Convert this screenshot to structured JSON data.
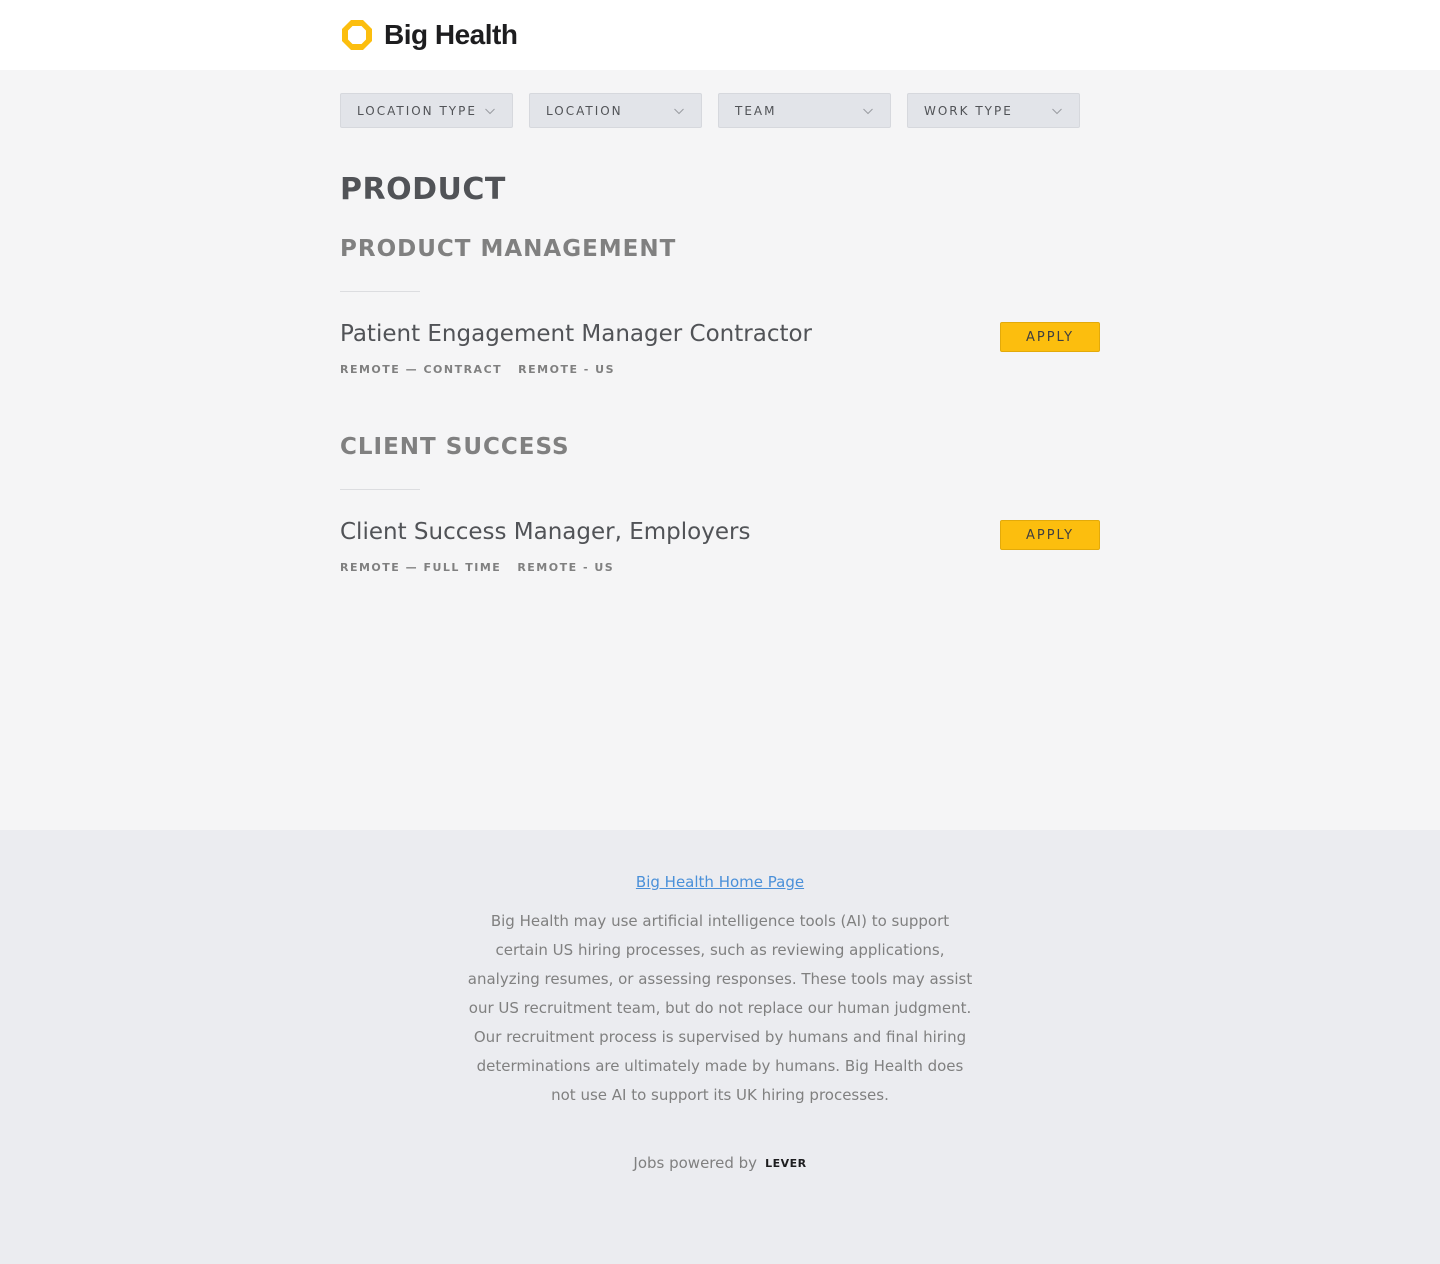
{
  "brand": {
    "name": "Big Health",
    "accent": "#fcbe0e"
  },
  "filters": [
    {
      "label": "LOCATION TYPE",
      "icon": "chevron-down-icon"
    },
    {
      "label": "LOCATION",
      "icon": "chevron-down-icon"
    },
    {
      "label": "TEAM",
      "icon": "chevron-down-icon"
    },
    {
      "label": "WORK TYPE",
      "icon": "chevron-down-icon"
    }
  ],
  "department": {
    "title": "PRODUCT",
    "teams": [
      {
        "title": "PRODUCT MANAGEMENT",
        "postings": [
          {
            "title": "Patient Engagement Manager Contractor",
            "commitment": "REMOTE — CONTRACT",
            "location": "REMOTE - US",
            "apply_label": "APPLY"
          }
        ]
      },
      {
        "title": "CLIENT SUCCESS",
        "postings": [
          {
            "title": "Client Success Manager, Employers",
            "commitment": "REMOTE — FULL TIME",
            "location": "REMOTE - US",
            "apply_label": "APPLY"
          }
        ]
      }
    ]
  },
  "footer": {
    "home_link": "Big Health Home Page",
    "disclaimer": "Big Health may use artificial intelligence tools (AI) to support certain US hiring processes, such as reviewing applications, analyzing resumes, or assessing responses. These tools may assist our US recruitment team, but do not replace our human judgment. Our recruitment process is supervised by humans and final hiring determinations are ultimately made by humans. Big Health does not use AI to support its UK hiring processes.",
    "powered_by": "Jobs powered by",
    "powered_brand": "LEVER"
  }
}
